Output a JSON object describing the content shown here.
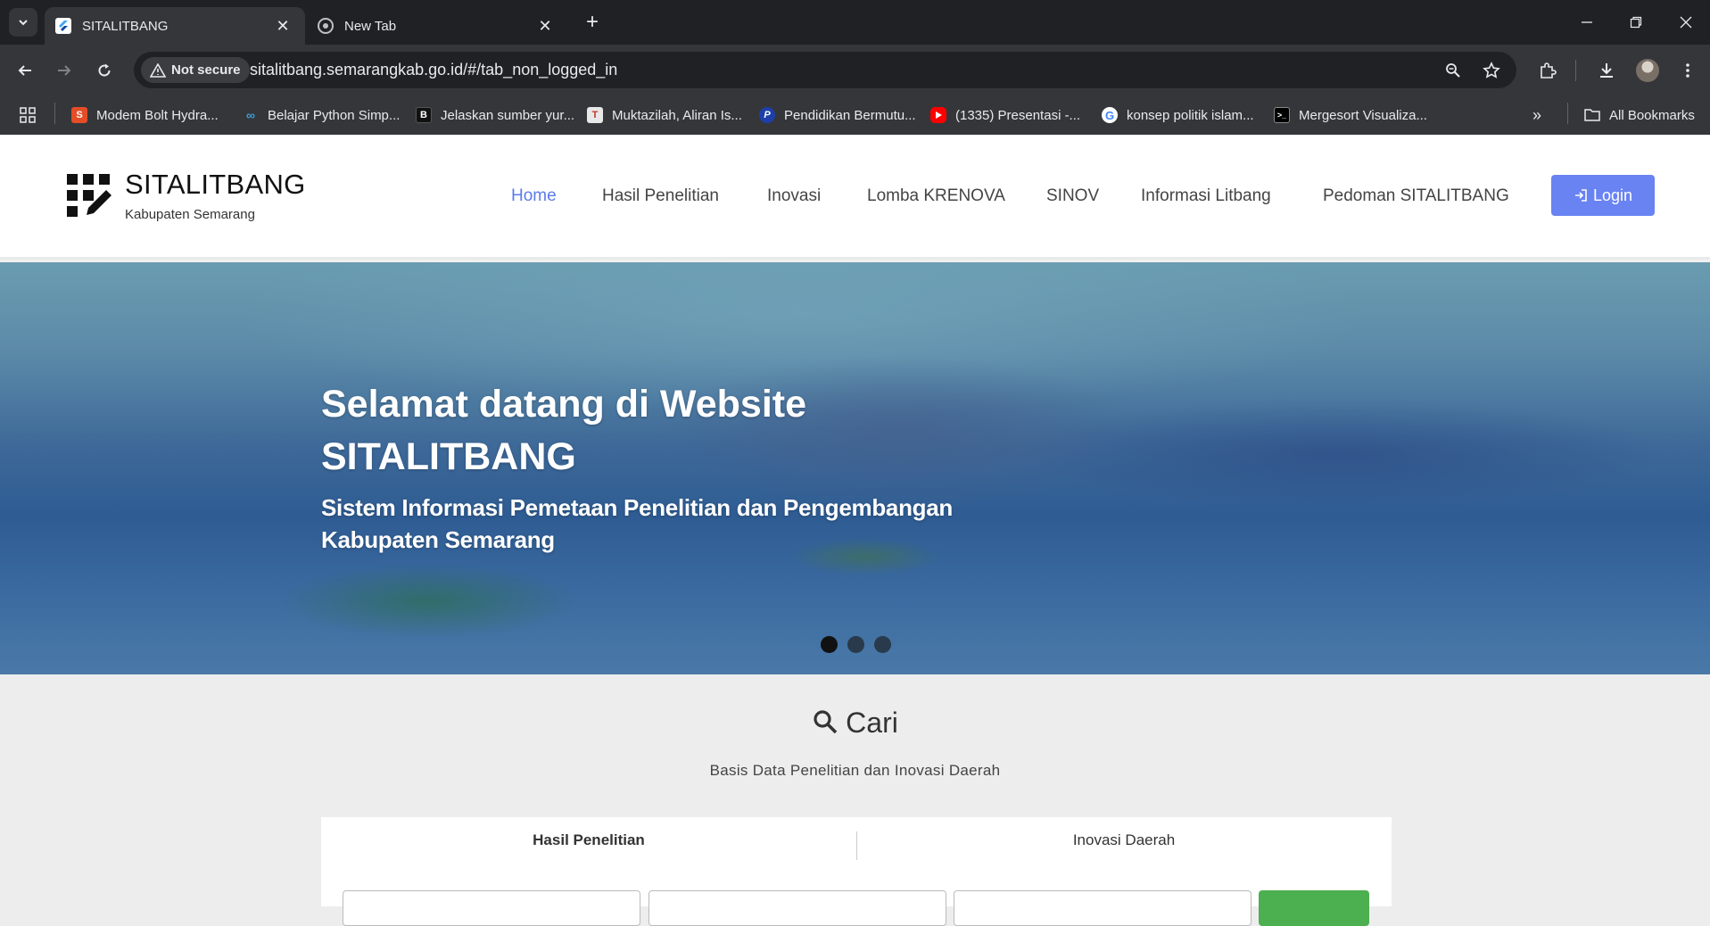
{
  "browser": {
    "tabs": [
      {
        "title": "SITALITBANG",
        "active": true
      },
      {
        "title": "New Tab",
        "active": false
      }
    ],
    "security_label": "Not secure",
    "url": "sitalitbang.semarangkab.go.id/#/tab_non_logged_in",
    "bookmarks": [
      {
        "label": "Modem Bolt Hydra...",
        "icon_color": "#e44d26"
      },
      {
        "label": "Belajar Python Simp...",
        "icon_color": "#3aa0d8"
      },
      {
        "label": "Jelaskan sumber yur...",
        "icon_color": "#111111"
      },
      {
        "label": "Muktazilah, Aliran Is...",
        "icon_color": "#e8e8e8"
      },
      {
        "label": "Pendidikan Bermutu...",
        "icon_color": "#1e3fa8"
      },
      {
        "label": "(1335) Presentasi -...",
        "icon_color": "#ff0000"
      },
      {
        "label": "konsep politik islam...",
        "icon_color": "#ffffff"
      },
      {
        "label": "Mergesort Visualiza...",
        "icon_color": "#000000"
      }
    ],
    "all_bookmarks_label": "All Bookmarks"
  },
  "site": {
    "brand": "SITALITBANG",
    "brand_sub": "Kabupaten Semarang",
    "nav": [
      {
        "label": "Home",
        "active": true
      },
      {
        "label": "Hasil Penelitian"
      },
      {
        "label": "Inovasi"
      },
      {
        "label": "Lomba KRENOVA"
      },
      {
        "label": "SINOV"
      },
      {
        "label": "Informasi Litbang"
      },
      {
        "label": "Pedoman SITALITBANG"
      }
    ],
    "login_label": "Login",
    "accent_color": "#6a83f2"
  },
  "hero": {
    "title": "Selamat datang di Website SITALITBANG",
    "subtitle": "Sistem Informasi Pemetaan Penelitian dan Pengembangan Kabupaten Semarang",
    "slides": 3,
    "active_slide": 1
  },
  "search": {
    "title": "Cari",
    "subtitle": "Basis Data Penelitian dan Inovasi Daerah",
    "tabs": [
      {
        "label": "Hasil Penelitian",
        "active": true
      },
      {
        "label": "Inovasi Daerah",
        "active": false
      }
    ],
    "button_color": "#4caf50"
  }
}
